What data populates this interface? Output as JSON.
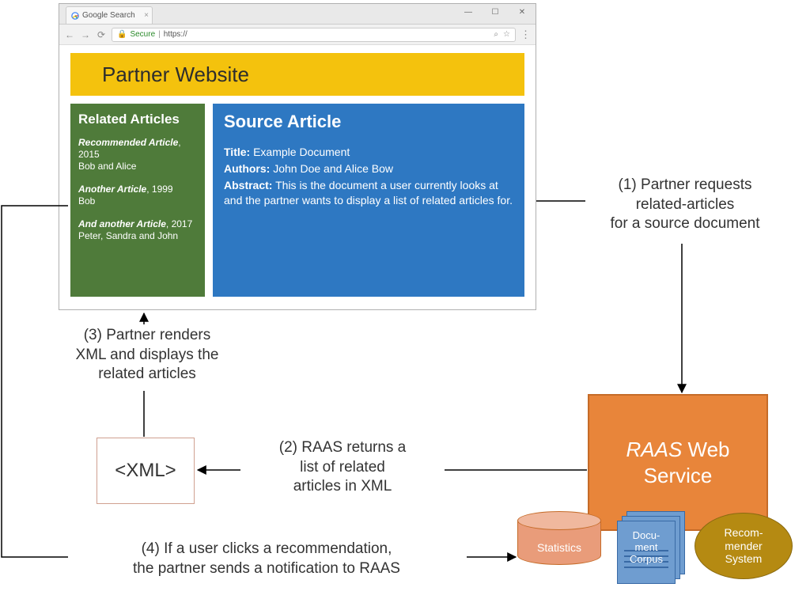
{
  "browser": {
    "tab_title": "Google Search",
    "win_min": "—",
    "win_max": "☐",
    "win_close": "✕",
    "nav_back": "←",
    "nav_fwd": "→",
    "nav_reload": "⟳",
    "secure_label": "Secure",
    "url_prefix": "https://",
    "lock_glyph": "🔒",
    "search_glyph": "⌕",
    "star_glyph": "☆",
    "menu_glyph": "⋮"
  },
  "page": {
    "banner": "Partner Website",
    "related": {
      "heading": "Related Articles",
      "items": [
        {
          "title": "Recommended Article",
          "year": "2015",
          "authors": "Bob and Alice"
        },
        {
          "title": "Another Article",
          "year": "1999",
          "authors": "Bob"
        },
        {
          "title": "And another Article",
          "year": "2017",
          "authors": "Peter, Sandra and John"
        }
      ]
    },
    "source": {
      "heading": "Source Article",
      "title_label": "Title:",
      "title_value": "Example Document",
      "authors_label": "Authors:",
      "authors_value": "John Doe and Alice Bow",
      "abstract_label": "Abstract:",
      "abstract_value": "This is the document a user currently looks at and the partner wants to display a list of related articles for."
    }
  },
  "xml_box": "<XML>",
  "raas": {
    "ital": "RAAS",
    "rest": " Web Service"
  },
  "db": {
    "statistics": "Statistics",
    "docs_l1": "Docu-",
    "docs_l2": "ment",
    "docs_l3": "Corpus",
    "rec_l1": "Recom-",
    "rec_l2": "mender",
    "rec_l3": "System"
  },
  "steps": {
    "s1_l1": "(1) Partner requests",
    "s1_l2": "related-articles",
    "s1_l3": "for a source document",
    "s2_l1": "(2) RAAS returns a",
    "s2_l2": "list of related",
    "s2_l3": "articles in XML",
    "s3_l1": "(3) Partner renders",
    "s3_l2": "XML and displays the",
    "s3_l3": "related articles",
    "s4_l1": "(4) If a user clicks a recommendation,",
    "s4_l2": "the partner sends a notification to RAAS"
  }
}
